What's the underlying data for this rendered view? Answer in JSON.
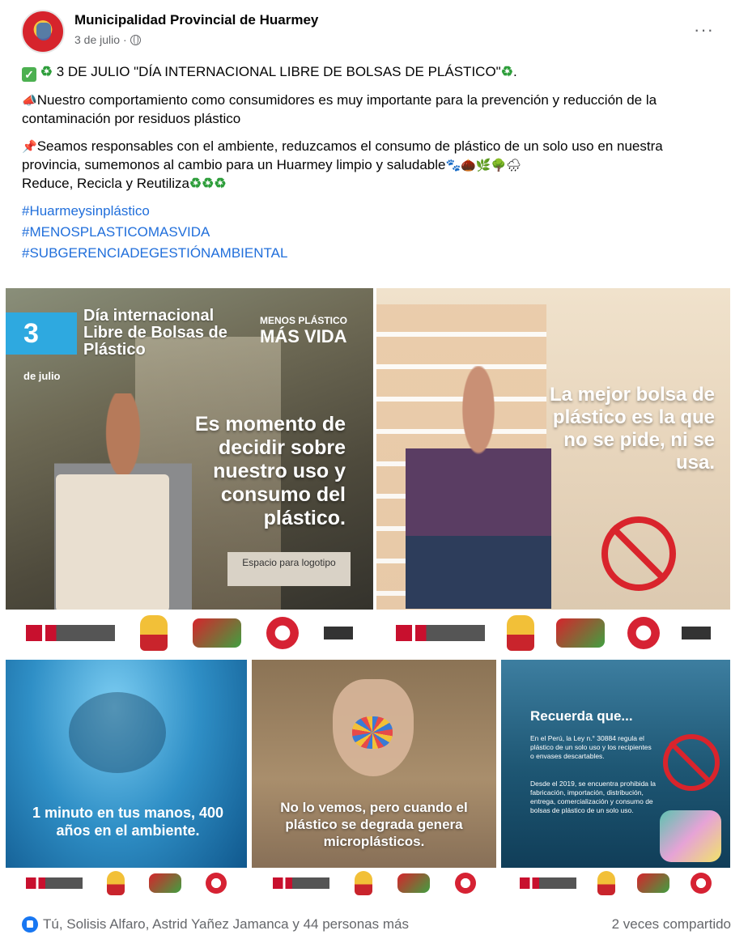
{
  "post": {
    "page_name": "Municipalidad Provincial de Huarmey",
    "date": "3 de julio",
    "separator": "·",
    "more_label": "···",
    "line1": "3 DE JULIO \"DÍA INTERNACIONAL LIBRE DE BOLSAS DE PLÁSTICO\"",
    "line2": "Nuestro comportamiento como consumidores es muy importante para la prevención y reducción de la contaminación por residuos plástico",
    "line3": "Seamos responsables con el ambiente, reduzcamos el consumo de plástico de un solo uso en nuestra provincia, sumemonos al cambio para un Huarmey limpio y saludable",
    "line4": "Reduce, Recicla y Reutiliza",
    "hashtags": [
      "#Huarmeysinplástico",
      "#MENOSPLASTICOMASVIDA",
      "#SUBGERENCIADEGESTIÓNAMBIENTAL"
    ]
  },
  "tiles": {
    "t1": {
      "date_number": "3",
      "date_suffix": "de julio",
      "title": "Día internacional Libre de Bolsas de Plástico",
      "slogan_top": "MENOS PLÁSTICO",
      "slogan_bottom": "MÁS VIDA",
      "main": "Es momento de decidir sobre nuestro uso y consumo del plástico.",
      "logo_space": "Espacio para logotipo"
    },
    "t2": {
      "main": "La mejor bolsa de plástico es la que no se pide, ni se usa."
    },
    "t3": {
      "main": "1 minuto en tus manos, 400 años en el ambiente."
    },
    "t4": {
      "main": "No lo vemos, pero cuando el plástico se degrada genera microplásticos."
    },
    "t5": {
      "heading": "Recuerda que...",
      "p1": "En el Perú, la Ley n.° 30884 regula el plástico de un solo uso y los recipientes o envases descartables.",
      "p2": "Desde el 2019, se encuentra prohibida la fabricación, importación, distribución, entrega, comercialización y consumo de bolsas de plástico de un solo uso."
    }
  },
  "footer": {
    "reactions": "Tú, Solisis Alfaro, Astrid Yañez Jamanca y 44 personas más",
    "shares": "2 veces compartido"
  },
  "icons": {
    "avatar": "municipality-logo",
    "privacy": "globe-icon",
    "like": "like-icon"
  },
  "colors": {
    "link": "#216fdb",
    "secondary_text": "#65676b",
    "like_blue": "#1877f2"
  }
}
